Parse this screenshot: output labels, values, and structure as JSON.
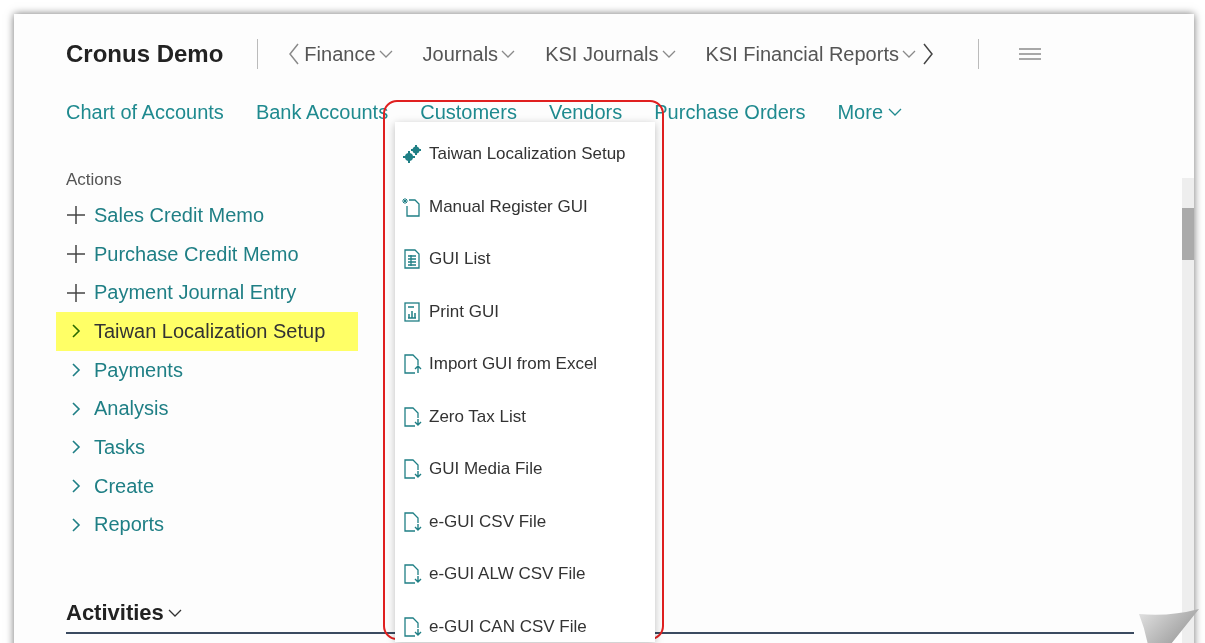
{
  "header": {
    "company": "Cronus Demo",
    "nav": [
      {
        "label": "Finance",
        "dropdown": true
      },
      {
        "label": "Journals",
        "dropdown": true
      },
      {
        "label": "KSI Journals",
        "dropdown": true
      },
      {
        "label": "KSI Financial Reports",
        "dropdown": true
      }
    ]
  },
  "links": [
    {
      "label": "Chart of Accounts",
      "dropdown": false
    },
    {
      "label": "Bank Accounts",
      "dropdown": false
    },
    {
      "label": "Customers",
      "dropdown": false
    },
    {
      "label": "Vendors",
      "dropdown": false
    },
    {
      "label": "Purchase Orders",
      "dropdown": false
    },
    {
      "label": "More",
      "dropdown": true
    }
  ],
  "actions": {
    "title": "Actions",
    "items": [
      {
        "kind": "new",
        "label": "Sales Credit Memo",
        "highlighted": false
      },
      {
        "kind": "new",
        "label": "Purchase Credit Memo",
        "highlighted": false
      },
      {
        "kind": "new",
        "label": "Payment Journal Entry",
        "highlighted": false
      },
      {
        "kind": "group",
        "label": "Taiwan Localization Setup",
        "highlighted": true
      },
      {
        "kind": "group",
        "label": "Payments",
        "highlighted": false
      },
      {
        "kind": "group",
        "label": "Analysis",
        "highlighted": false
      },
      {
        "kind": "group",
        "label": "Tasks",
        "highlighted": false
      },
      {
        "kind": "group",
        "label": "Create",
        "highlighted": false
      },
      {
        "kind": "group",
        "label": "Reports",
        "highlighted": false
      }
    ]
  },
  "menu": {
    "items": [
      {
        "kind": "setup",
        "label": "Taiwan Localization Setup"
      },
      {
        "kind": "new",
        "label": "Manual Register GUI"
      },
      {
        "kind": "list",
        "label": "GUI List"
      },
      {
        "kind": "report",
        "label": "Print GUI"
      },
      {
        "kind": "import",
        "label": "Import GUI from Excel"
      },
      {
        "kind": "export",
        "label": "Zero Tax List"
      },
      {
        "kind": "export",
        "label": "GUI Media File"
      },
      {
        "kind": "export",
        "label": "e-GUI CSV File"
      },
      {
        "kind": "export",
        "label": "e-GUI ALW CSV File"
      },
      {
        "kind": "export",
        "label": "e-GUI CAN CSV File"
      }
    ]
  },
  "activities": {
    "title": "Activities"
  }
}
